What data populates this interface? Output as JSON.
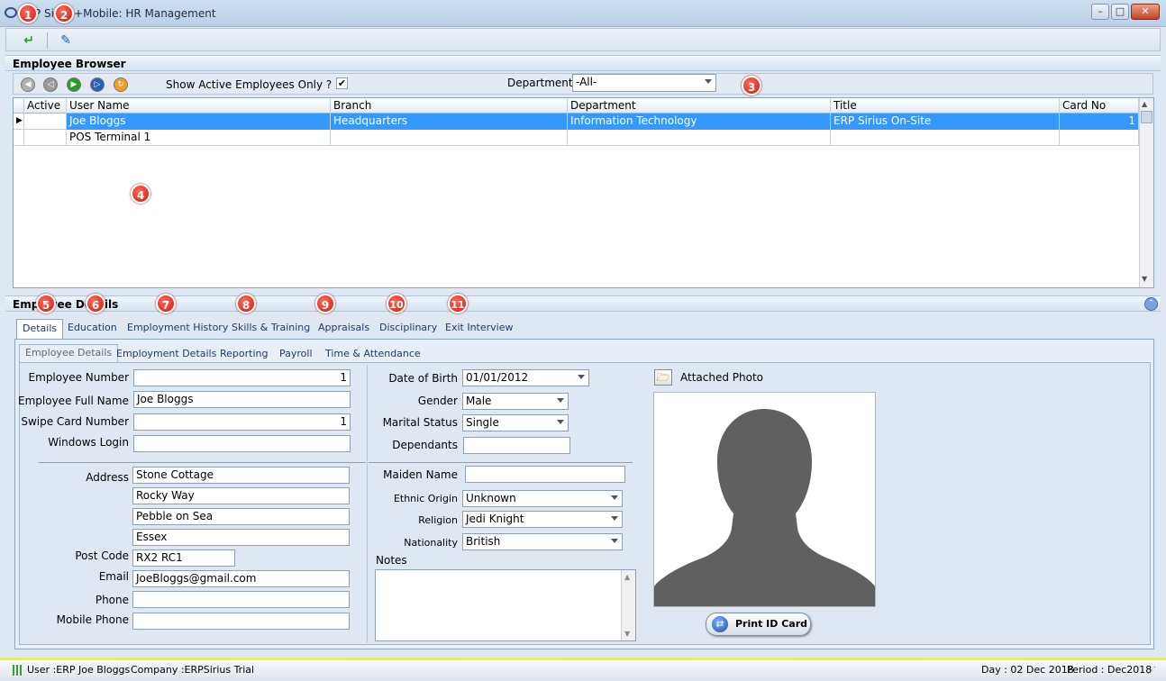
{
  "window": {
    "title": "ERP Sirius+Mobile: HR Management",
    "minimize": "–",
    "maximize": "□",
    "close": "✕"
  },
  "browser": {
    "section_title": "Employee Browser",
    "show_active_label": "Show Active Employees Only ?",
    "show_active_checked": true,
    "department_label": "Department",
    "department_value": "-All-",
    "columns": [
      "Active",
      "User Name",
      "Branch",
      "Department",
      "Title",
      "Card No"
    ],
    "rows": [
      {
        "active": "",
        "user": "Joe Bloggs",
        "branch": "Headquarters",
        "department": "Information Technology",
        "title": "ERP Sirius On-Site",
        "card": "1",
        "selected": true
      },
      {
        "active": "",
        "user": "POS Terminal 1",
        "branch": "",
        "department": "",
        "title": "",
        "card": "",
        "selected": false
      }
    ]
  },
  "details": {
    "section_title": "Employee Details",
    "tabs": [
      "Details",
      "Education",
      "Employment History",
      "Skills & Training",
      "Appraisals",
      "Disciplinary",
      "Exit Interview"
    ],
    "subtabs": [
      "Employee Details",
      "Employment Details",
      "Reporting",
      "Payroll",
      "Time & Attendance"
    ],
    "fields": {
      "employee_number_label": "Employee Number",
      "employee_number": "1",
      "full_name_label": "Employee Full Name",
      "full_name": "Joe Bloggs",
      "swipe_label": "Swipe Card Number",
      "swipe": "1",
      "windows_login_label": "Windows Login",
      "windows_login": "",
      "address_label": "Address",
      "address1": "Stone Cottage",
      "address2": "Rocky Way",
      "address3": "Pebble on Sea",
      "address4": "Essex",
      "postcode_label": "Post Code",
      "postcode": "RX2 RC1",
      "email_label": "Email",
      "email": "JoeBloggs@gmail.com",
      "phone_label": "Phone",
      "phone": "",
      "mobile_label": "Mobile Phone",
      "mobile": "",
      "dob_label": "Date of Birth",
      "dob": "01/01/2012",
      "gender_label": "Gender",
      "gender": "Male",
      "marital_label": "Marital Status",
      "marital": "Single",
      "dependants_label": "Dependants",
      "dependants": "",
      "maiden_label": "Maiden Name",
      "maiden": "",
      "ethnic_label": "Ethnic Origin",
      "ethnic": "Unknown",
      "religion_label": "Religion",
      "religion": "Jedi Knight",
      "nationality_label": "Nationality",
      "nationality": "British",
      "notes_label": "Notes",
      "notes": ""
    },
    "photo_label": "Attached Photo",
    "print_button": "Print ID Card"
  },
  "badges": [
    "1",
    "2",
    "3",
    "4",
    "5",
    "6",
    "7",
    "8",
    "9",
    "10",
    "11"
  ],
  "status": {
    "user": "User :ERP Joe Bloggs",
    "company": "Company :ERPSirius Trial",
    "day": "Day : 02 Dec 2018",
    "period": "Period : Dec2018"
  }
}
